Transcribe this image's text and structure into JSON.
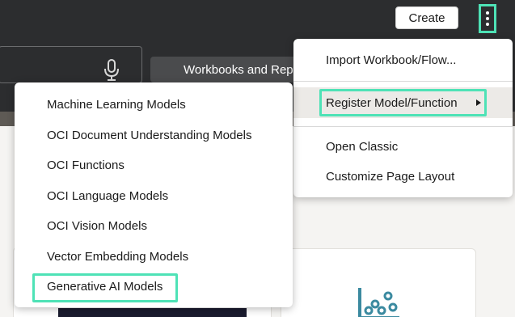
{
  "header": {
    "create_label": "Create",
    "tab_label": "Workbooks and Rep"
  },
  "main_menu": {
    "items": [
      "Import Workbook/Flow...",
      "Register Model/Function",
      "Open Classic",
      "Customize Page Layout"
    ]
  },
  "sub_menu": {
    "items": [
      "Machine Learning Models",
      "OCI Document Understanding Models",
      "OCI Functions",
      "OCI Language Models",
      "OCI Vision Models",
      "Vector Embedding Models",
      "Generative AI Models"
    ]
  },
  "colors": {
    "topbar": "#2c2d2f",
    "highlight_outline": "#4ee2b6",
    "icon_teal": "#3b8aa0"
  },
  "icons": [
    "kebab-menu-icon",
    "microphone-icon",
    "chevron-right-icon",
    "scatter-plot-icon"
  ]
}
